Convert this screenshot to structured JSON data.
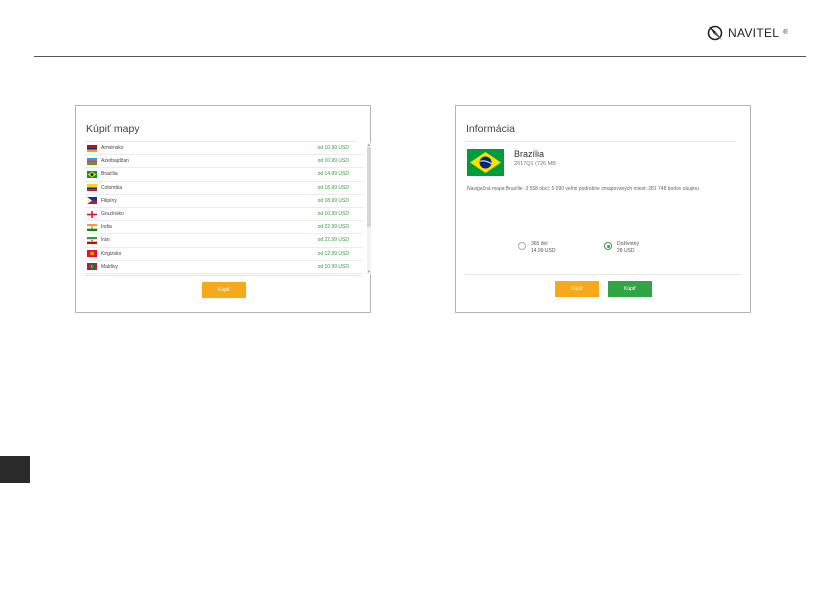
{
  "logo": {
    "text": "NAVITEL",
    "mark": "®"
  },
  "buy_panel": {
    "title": "Kúpiť mapy",
    "countries": [
      {
        "name": "Arménsko",
        "price": "od 10.99 USD",
        "flag": "armenia"
      },
      {
        "name": "Azerbajdžan",
        "price": "od 10.99 USD",
        "flag": "azerbaijan"
      },
      {
        "name": "Brazília",
        "price": "od 14.99 USD",
        "flag": "brazil"
      },
      {
        "name": "Colombia",
        "price": "od 18.99 USD",
        "flag": "colombia"
      },
      {
        "name": "Filipíny",
        "price": "od 18.99 USD",
        "flag": "philippines"
      },
      {
        "name": "Gruzínsko",
        "price": "od 10.99 USD",
        "flag": "georgia"
      },
      {
        "name": "India",
        "price": "od 22.99 USD",
        "flag": "india"
      },
      {
        "name": "Irán",
        "price": "od 22.99 USD",
        "flag": "iran"
      },
      {
        "name": "Kirgizsko",
        "price": "od 12.99 USD",
        "flag": "kyrgyzstan"
      },
      {
        "name": "Maldivy",
        "price": "od 10.99 USD",
        "flag": "maldives"
      }
    ],
    "buy_label": "Kúpiť"
  },
  "info_panel": {
    "title": "Informácia",
    "map_name": "Brazília",
    "map_meta": "2017Q1 (726 MB",
    "description": "Navigačná mapa Brazílie: 3 558 obcí; 5 090 veľmi podrobne zmapovaných miest; 281 748 bodov záujmu",
    "options": [
      {
        "label": "365 dní",
        "price": "14.99 USD",
        "checked": false
      },
      {
        "label": "Doživotný",
        "price": "28 USD",
        "checked": true
      }
    ],
    "buy_label": "Kúpiť",
    "confirm_label": "Kúpiť"
  },
  "colors": {
    "accent_orange": "#f7a81b",
    "accent_green": "#2fa545",
    "price_green": "#3c9a3c"
  }
}
